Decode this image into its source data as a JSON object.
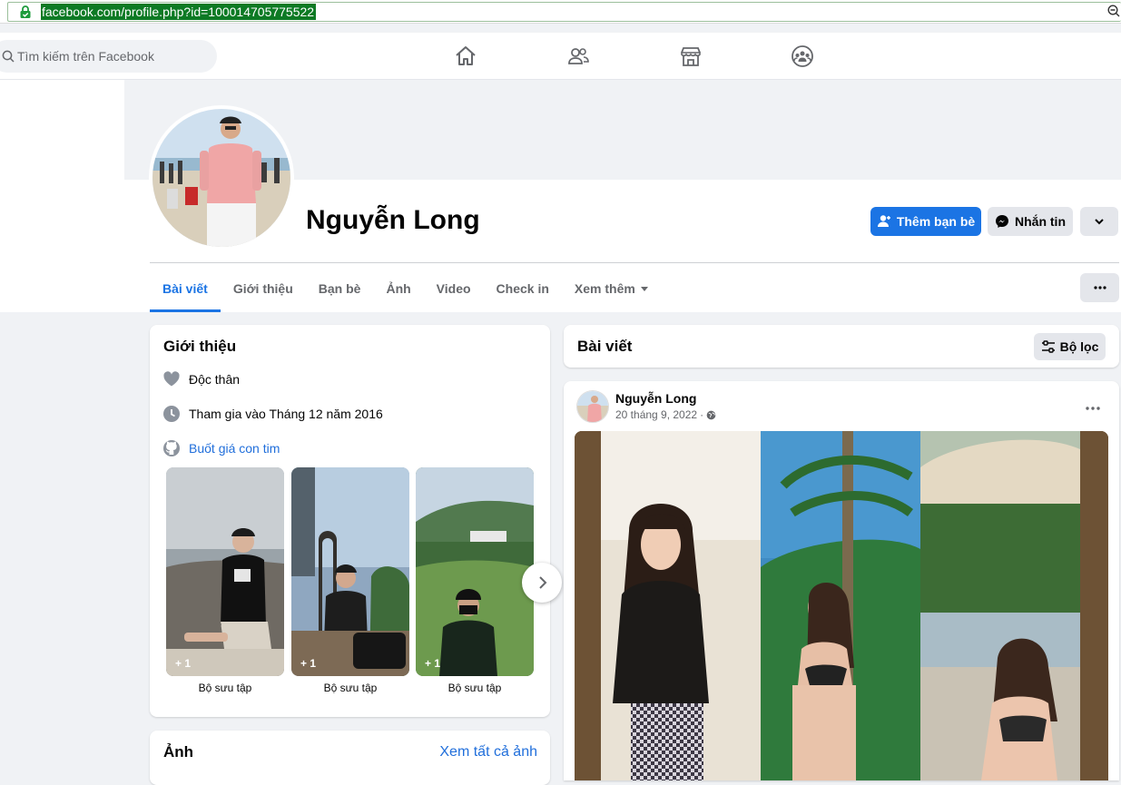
{
  "browser": {
    "url": "facebook.com/profile.php?id=100014705775522"
  },
  "topnav": {
    "search_placeholder": "Tìm kiếm trên Facebook",
    "icons": [
      "home-icon",
      "friends-icon",
      "marketplace-icon",
      "groups-icon"
    ]
  },
  "profile": {
    "name": "Nguyễn Long",
    "add_friend_label": "Thêm bạn bè",
    "message_label": "Nhắn tin"
  },
  "tabs": [
    {
      "label": "Bài viết",
      "active": true
    },
    {
      "label": "Giới thiệu"
    },
    {
      "label": "Bạn bè"
    },
    {
      "label": "Ảnh"
    },
    {
      "label": "Video"
    },
    {
      "label": "Check in"
    },
    {
      "label": "Xem thêm"
    }
  ],
  "intro": {
    "title": "Giới thiệu",
    "relationship": "Độc thân",
    "joined": "Tham gia vào Tháng 12 năm 2016",
    "github": "Buốt giá con tim",
    "collections": [
      {
        "label": "Bộ sưu tập",
        "count": "+ 1"
      },
      {
        "label": "Bộ sưu tập",
        "count": "+ 1"
      },
      {
        "label": "Bộ sưu tập",
        "count": "+ 1"
      }
    ]
  },
  "photos": {
    "title": "Ảnh",
    "see_all": "Xem tất cả ảnh"
  },
  "posts": {
    "title": "Bài viết",
    "filter_label": "Bộ lọc",
    "items": [
      {
        "author": "Nguyễn Long",
        "date": "20 tháng 9, 2022"
      }
    ]
  },
  "colors": {
    "accent": "#1b74e4",
    "link": "#216fdb",
    "url_highlight": "#0d7a24"
  }
}
